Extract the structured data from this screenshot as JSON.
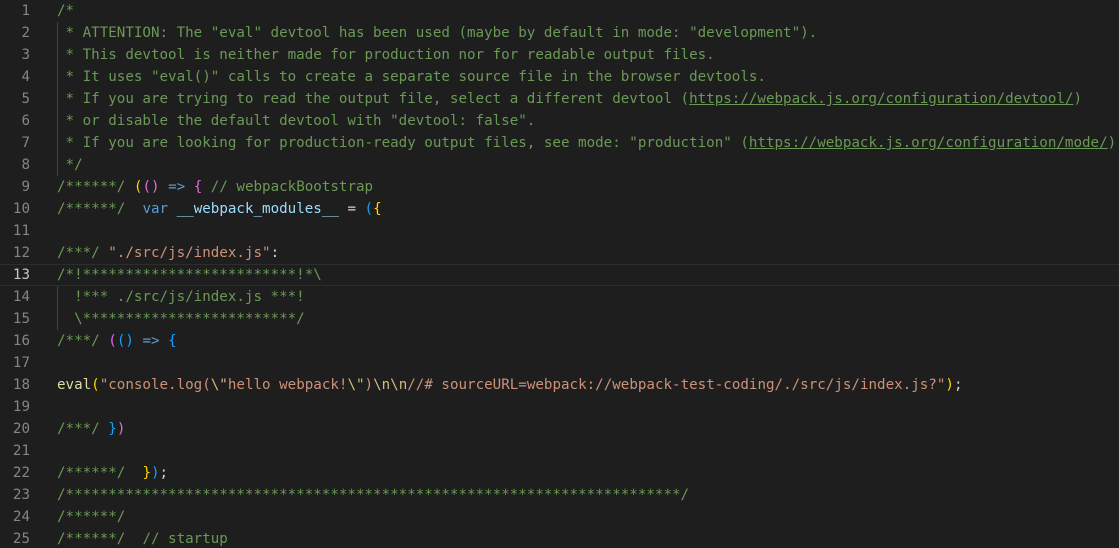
{
  "editor": {
    "lines": [
      {
        "num": "1",
        "segs": [
          {
            "t": "/*",
            "c": "c"
          }
        ]
      },
      {
        "num": "2",
        "segs": [
          {
            "t": " * ATTENTION: The \"eval\" devtool has been used (maybe by default in mode: \"development\").",
            "c": "c"
          }
        ]
      },
      {
        "num": "3",
        "segs": [
          {
            "t": " * This devtool is neither made for production nor for readable output files.",
            "c": "c"
          }
        ]
      },
      {
        "num": "4",
        "segs": [
          {
            "t": " * It uses \"eval()\" calls to create a separate source file in the browser devtools.",
            "c": "c"
          }
        ]
      },
      {
        "num": "5",
        "segs": [
          {
            "t": " * If you are trying to read the output file, select a different devtool (",
            "c": "c"
          },
          {
            "t": "https://webpack.js.org/configuration/devtool/",
            "c": "c u"
          },
          {
            "t": ")",
            "c": "c"
          }
        ]
      },
      {
        "num": "6",
        "segs": [
          {
            "t": " * or disable the default devtool with \"devtool: false\".",
            "c": "c"
          }
        ]
      },
      {
        "num": "7",
        "segs": [
          {
            "t": " * If you are looking for production-ready output files, see mode: \"production\" (",
            "c": "c"
          },
          {
            "t": "https://webpack.js.org/configuration/mode/",
            "c": "c u"
          },
          {
            "t": ").",
            "c": "c"
          }
        ]
      },
      {
        "num": "8",
        "segs": [
          {
            "t": " */",
            "c": "c"
          }
        ]
      },
      {
        "num": "9",
        "segs": [
          {
            "t": "/******/",
            "c": "c"
          },
          {
            "t": " ",
            "c": "p"
          },
          {
            "t": "(",
            "c": "b1"
          },
          {
            "t": "()",
            "c": "b2"
          },
          {
            "t": " ",
            "c": "p"
          },
          {
            "t": "=>",
            "c": "k"
          },
          {
            "t": " ",
            "c": "p"
          },
          {
            "t": "{",
            "c": "b2"
          },
          {
            "t": " // webpackBootstrap",
            "c": "c"
          }
        ]
      },
      {
        "num": "10",
        "segs": [
          {
            "t": "/******/",
            "c": "c"
          },
          {
            "t": "  ",
            "c": "p"
          },
          {
            "t": "var",
            "c": "k"
          },
          {
            "t": " ",
            "c": "p"
          },
          {
            "t": "__webpack_modules__",
            "c": "v"
          },
          {
            "t": " = ",
            "c": "p"
          },
          {
            "t": "(",
            "c": "b3"
          },
          {
            "t": "{",
            "c": "b1"
          }
        ]
      },
      {
        "num": "11",
        "segs": []
      },
      {
        "num": "12",
        "segs": [
          {
            "t": "/***/",
            "c": "c"
          },
          {
            "t": " ",
            "c": "p"
          },
          {
            "t": "\"./src/js/index.js\"",
            "c": "s"
          },
          {
            "t": ":",
            "c": "p"
          }
        ]
      },
      {
        "num": "13",
        "current": true,
        "segs": [
          {
            "t": "/*!*************************!*\\",
            "c": "c"
          }
        ]
      },
      {
        "num": "14",
        "segs": [
          {
            "t": "  !*** ./src/js/index.js ***!",
            "c": "c"
          }
        ]
      },
      {
        "num": "15",
        "segs": [
          {
            "t": "  \\*************************/",
            "c": "c"
          }
        ]
      },
      {
        "num": "16",
        "segs": [
          {
            "t": "/***/",
            "c": "c"
          },
          {
            "t": " ",
            "c": "p"
          },
          {
            "t": "(",
            "c": "b2"
          },
          {
            "t": "()",
            "c": "b3"
          },
          {
            "t": " ",
            "c": "p"
          },
          {
            "t": "=>",
            "c": "k"
          },
          {
            "t": " ",
            "c": "p"
          },
          {
            "t": "{",
            "c": "b3"
          }
        ]
      },
      {
        "num": "17",
        "segs": []
      },
      {
        "num": "18",
        "segs": [
          {
            "t": "eval",
            "c": "f"
          },
          {
            "t": "(",
            "c": "b1"
          },
          {
            "t": "\"console.log(",
            "c": "s"
          },
          {
            "t": "\\\"",
            "c": "e"
          },
          {
            "t": "hello webpack!",
            "c": "s"
          },
          {
            "t": "\\\"",
            "c": "e"
          },
          {
            "t": ")",
            "c": "s"
          },
          {
            "t": "\\n\\n",
            "c": "e"
          },
          {
            "t": "//# sourceURL=webpack://webpack-test-coding/./src/js/index.js?\"",
            "c": "s"
          },
          {
            "t": ")",
            "c": "b1"
          },
          {
            "t": ";",
            "c": "p"
          }
        ]
      },
      {
        "num": "19",
        "segs": []
      },
      {
        "num": "20",
        "segs": [
          {
            "t": "/***/",
            "c": "c"
          },
          {
            "t": " ",
            "c": "p"
          },
          {
            "t": "}",
            "c": "b3"
          },
          {
            "t": ")",
            "c": "b2"
          }
        ]
      },
      {
        "num": "21",
        "segs": []
      },
      {
        "num": "22",
        "segs": [
          {
            "t": "/******/",
            "c": "c"
          },
          {
            "t": "  ",
            "c": "p"
          },
          {
            "t": "}",
            "c": "b1"
          },
          {
            "t": ")",
            "c": "b3"
          },
          {
            "t": ";",
            "c": "p"
          }
        ]
      },
      {
        "num": "23",
        "segs": [
          {
            "t": "/************************************************************************/",
            "c": "c"
          }
        ]
      },
      {
        "num": "24",
        "segs": [
          {
            "t": "/******/",
            "c": "c"
          }
        ]
      },
      {
        "num": "25",
        "segs": [
          {
            "t": "/******/",
            "c": "c"
          },
          {
            "t": "  ",
            "c": "p"
          },
          {
            "t": "// startup",
            "c": "c"
          }
        ]
      }
    ]
  }
}
